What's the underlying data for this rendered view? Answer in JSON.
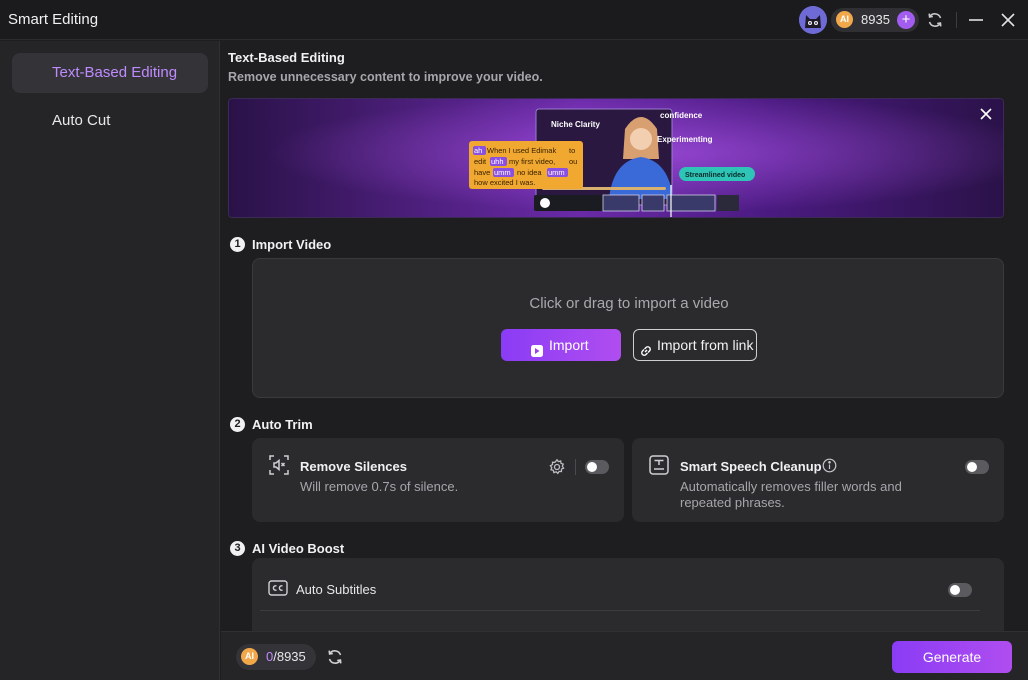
{
  "app": {
    "title": "Smart Editing"
  },
  "header": {
    "credits": "8935",
    "ai_badge": "AI",
    "add_label": "+"
  },
  "sidebar": {
    "items": [
      {
        "label": "Text-Based Editing",
        "active": true
      },
      {
        "label": "Auto Cut",
        "active": false
      }
    ]
  },
  "main": {
    "title": "Text-Based Editing",
    "subtitle": "Remove unnecessary content to improve your video.",
    "banner": {
      "tags": [
        "Niche Clarity",
        "confidence",
        "Experimenting",
        "Streamlined video"
      ],
      "transcript_lines": [
        [
          "ah",
          "When I used Edimak",
          "to"
        ],
        [
          "edit",
          "uhh",
          "my  first video,",
          "ou"
        ],
        [
          "have",
          "umm",
          "no idea",
          "umm"
        ],
        [
          "how excited I was."
        ]
      ]
    },
    "steps": [
      {
        "num": "1",
        "title": "Import Video"
      },
      {
        "num": "2",
        "title": "Auto Trim"
      },
      {
        "num": "3",
        "title": "AI Video Boost"
      }
    ],
    "import": {
      "hint": "Click or drag to import a video",
      "import_label": "Import",
      "link_label": "Import from link"
    },
    "auto_trim": {
      "remove_silences": {
        "title": "Remove Silences",
        "desc": "Will remove 0.7s of silence.",
        "enabled": false
      },
      "speech_cleanup": {
        "title": "Smart Speech Cleanup",
        "desc": "Automatically removes filler words and repeated phrases.",
        "enabled": false
      }
    },
    "boost": {
      "auto_subtitles": {
        "label": "Auto Subtitles",
        "enabled": false
      }
    }
  },
  "footer": {
    "used": "0",
    "total": "/8935",
    "generate_label": "Generate"
  },
  "colors": {
    "accent": "#a35cf0",
    "active_text": "#c08bff",
    "coin": "#f2a84a"
  }
}
